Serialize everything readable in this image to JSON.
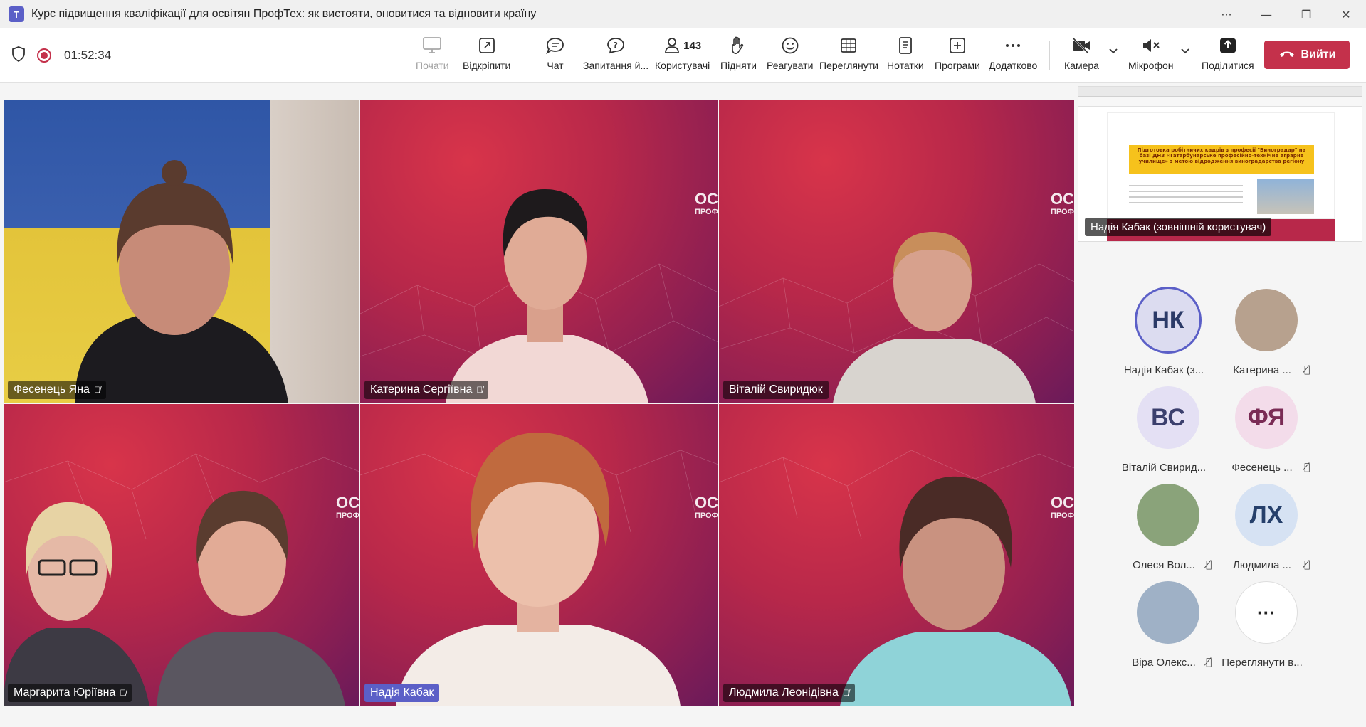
{
  "window": {
    "app_icon": "T",
    "title": "Курс підвищення кваліфікації для освітян ПрофТех: як вистояти, оновитися та відновити країну",
    "more": "···",
    "minimize": "—",
    "restore": "❐",
    "close": "✕"
  },
  "toolbar": {
    "timer": "01:52:34",
    "start": "Почати",
    "popout": "Відкріпити",
    "chat": "Чат",
    "qa": "Запитання й...",
    "people_count": "143",
    "people": "Користувачі",
    "raise": "Підняти",
    "react": "Реагувати",
    "view": "Переглянути",
    "notes": "Нотатки",
    "apps": "Програми",
    "more": "Додатково",
    "camera": "Камера",
    "mic": "Мікрофон",
    "share": "Поділитися",
    "leave": "Вийти"
  },
  "tiles": [
    {
      "name": "Фесенець Яна",
      "muted": true
    },
    {
      "name": "Катерина Сергіївна",
      "muted": true
    },
    {
      "name": "Віталій Свиридюк",
      "muted": false
    },
    {
      "name": "Маргарита Юріївна",
      "muted": true
    },
    {
      "name": "Надія Кабак",
      "muted": false,
      "highlight": true
    },
    {
      "name": "Людмила Леонідівна",
      "muted": true
    }
  ],
  "watermark": {
    "line1": "ОС",
    "line2": "ПРОФ"
  },
  "share": {
    "presenter": "Надія Кабак (зовнішній користувач)",
    "slide_title": "Підготовка робітничих кадрів з професії \"Виноградар\" на базі ДНЗ «Татарбунарське професійно-технічне аграрне училище» з метою відродження виноградарства регіону"
  },
  "roster": [
    {
      "initials": "НК",
      "name": "Надія Кабак (з...",
      "muted": false,
      "bg": "#dcdcf0",
      "fg": "#2b3a67"
    },
    {
      "initials": "",
      "name": "Катерина ...",
      "muted": true,
      "bg": "#b7a18e",
      "fg": "#fff"
    },
    {
      "initials": "ВС",
      "name": "Віталій Свирид...",
      "muted": false,
      "bg": "#e4e0f4",
      "fg": "#3b3f6d"
    },
    {
      "initials": "ФЯ",
      "name": "Фесенець ...",
      "muted": true,
      "bg": "#f3dcea",
      "fg": "#7a2b55"
    },
    {
      "initials": "",
      "name": "Олеся Вол...",
      "muted": true,
      "bg": "#8aa37a",
      "fg": "#fff"
    },
    {
      "initials": "ЛХ",
      "name": "Людмила ...",
      "muted": true,
      "bg": "#d6e2f3",
      "fg": "#26406b"
    },
    {
      "initials": "",
      "name": "Віра Олекс...",
      "muted": true,
      "bg": "#9fb1c6",
      "fg": "#fff"
    },
    {
      "initials": "···",
      "name": "Переглянути в...",
      "muted": false,
      "bg": "#ffffff",
      "fg": "#222"
    }
  ],
  "colors": {
    "accent": "#5b5fc7",
    "leave": "#c4314b",
    "tile_bg": "#b8284a"
  }
}
